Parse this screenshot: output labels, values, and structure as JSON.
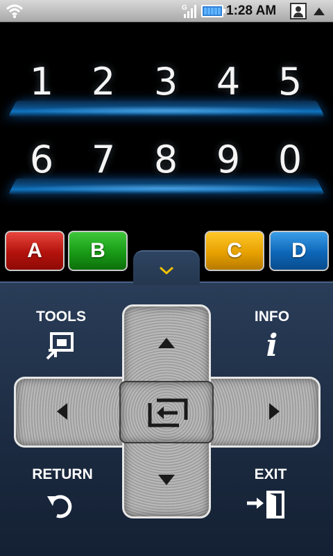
{
  "status_bar": {
    "time": "1:28 AM",
    "network_label": "G",
    "icons": [
      "wifi-icon",
      "signal-icon",
      "battery-icon",
      "contact-icon",
      "notification-arrow-icon"
    ]
  },
  "number_pad": {
    "row1": [
      "1",
      "2",
      "3",
      "4",
      "5"
    ],
    "row2": [
      "6",
      "7",
      "8",
      "9",
      "0"
    ]
  },
  "color_buttons": {
    "a": {
      "label": "A",
      "color": "#c41a12"
    },
    "b": {
      "label": "B",
      "color": "#1f9e1c"
    },
    "c": {
      "label": "C",
      "color": "#f0aa00"
    },
    "d": {
      "label": "D",
      "color": "#0f6fc4"
    }
  },
  "panel": {
    "tools_label": "TOOLS",
    "info_label": "INFO",
    "return_label": "RETURN",
    "exit_label": "EXIT",
    "collapse_icon": "chevron-down-icon",
    "accent": "#f2c200"
  },
  "dpad": {
    "icons": [
      "arrow-up-icon",
      "arrow-down-icon",
      "arrow-left-icon",
      "arrow-right-icon",
      "source-enter-icon"
    ]
  }
}
